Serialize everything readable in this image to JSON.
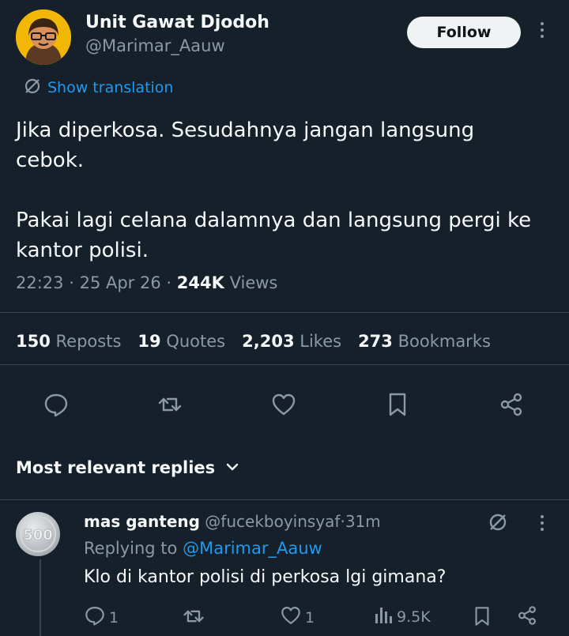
{
  "tweet": {
    "author_name": "Unit Gawat Djodoh",
    "author_handle": "@Marimar_Aauw",
    "follow_label": "Follow",
    "translate_label": "Show translation",
    "paragraph_1": "Jika diperkosa. Sesudahnya jangan langsung cebok.",
    "paragraph_2": "Pakai lagi celana dalamnya dan langsung pergi ke kantor polisi.",
    "time": "22:23",
    "date": "25 Apr 26",
    "views_count": "244K",
    "views_label": "Views",
    "sep": "·"
  },
  "stats": {
    "reposts_count": "150",
    "reposts_label": "Reposts",
    "quotes_count": "19",
    "quotes_label": "Quotes",
    "likes_count": "2,203",
    "likes_label": "Likes",
    "bookmarks_count": "273",
    "bookmarks_label": "Bookmarks"
  },
  "actions": [
    "reply-icon",
    "repost-icon",
    "like-icon",
    "bookmark-icon",
    "share-icon"
  ],
  "replies_header": "Most relevant replies",
  "reply": {
    "name": "mas ganteng",
    "handle": "@fucekboyinsyaf",
    "sep": "·",
    "age": "31m",
    "replying_prefix": "Replying to",
    "replying_to": "@Marimar_Aauw",
    "text": "Klo di kantor polisi di perkosa lgi gimana?",
    "reply_count": "1",
    "like_count": "1",
    "views": "9.5K",
    "avatar_coin_text": "500"
  },
  "colors": {
    "background": "#15202b",
    "text": "#f7f9f9",
    "muted": "#8b98a5",
    "accent": "#1d9bf0",
    "divider": "#38444d",
    "follow_bg": "#eff3f4"
  }
}
